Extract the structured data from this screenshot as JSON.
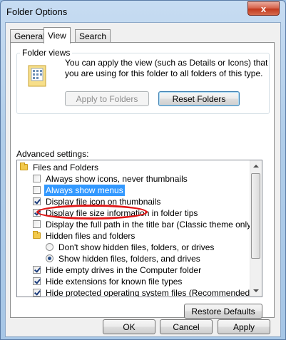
{
  "window": {
    "title": "Folder Options",
    "close_glyph": "x"
  },
  "tabs": [
    {
      "label": "General",
      "active": false
    },
    {
      "label": "View",
      "active": true
    },
    {
      "label": "Search",
      "active": false
    }
  ],
  "folder_views": {
    "heading": "Folder views",
    "description": "You can apply the view (such as Details or Icons) that you are using for this folder to all folders of this type.",
    "apply_label": "Apply to Folders",
    "reset_label": "Reset Folders"
  },
  "advanced": {
    "heading": "Advanced settings:",
    "items": [
      {
        "type": "folder",
        "label": "Files and Folders"
      },
      {
        "type": "checkbox",
        "label": "Always show icons, never thumbnails",
        "checked": false
      },
      {
        "type": "checkbox",
        "label": "Always show menus",
        "checked": false,
        "selected": true
      },
      {
        "type": "checkbox",
        "label": "Display file icon on thumbnails",
        "checked": true
      },
      {
        "type": "checkbox",
        "label": "Display file size information in folder tips",
        "checked": true
      },
      {
        "type": "checkbox",
        "label": "Display the full path in the title bar (Classic theme only)",
        "checked": false
      },
      {
        "type": "folder",
        "label": "Hidden files and folders"
      },
      {
        "type": "radio",
        "label": "Don't show hidden files, folders, or drives",
        "checked": false
      },
      {
        "type": "radio",
        "label": "Show hidden files, folders, and drives",
        "checked": true
      },
      {
        "type": "checkbox",
        "label": "Hide empty drives in the Computer folder",
        "checked": true
      },
      {
        "type": "checkbox",
        "label": "Hide extensions for known file types",
        "checked": true
      },
      {
        "type": "checkbox",
        "label": "Hide protected operating system files (Recommended)",
        "checked": true
      }
    ],
    "restore_label": "Restore Defaults"
  },
  "footer": {
    "ok_label": "OK",
    "cancel_label": "Cancel",
    "apply_label": "Apply"
  },
  "colors": {
    "selection": "#3399ff",
    "annotation_circle": "#e01818",
    "close_button": "#c23a1f"
  }
}
